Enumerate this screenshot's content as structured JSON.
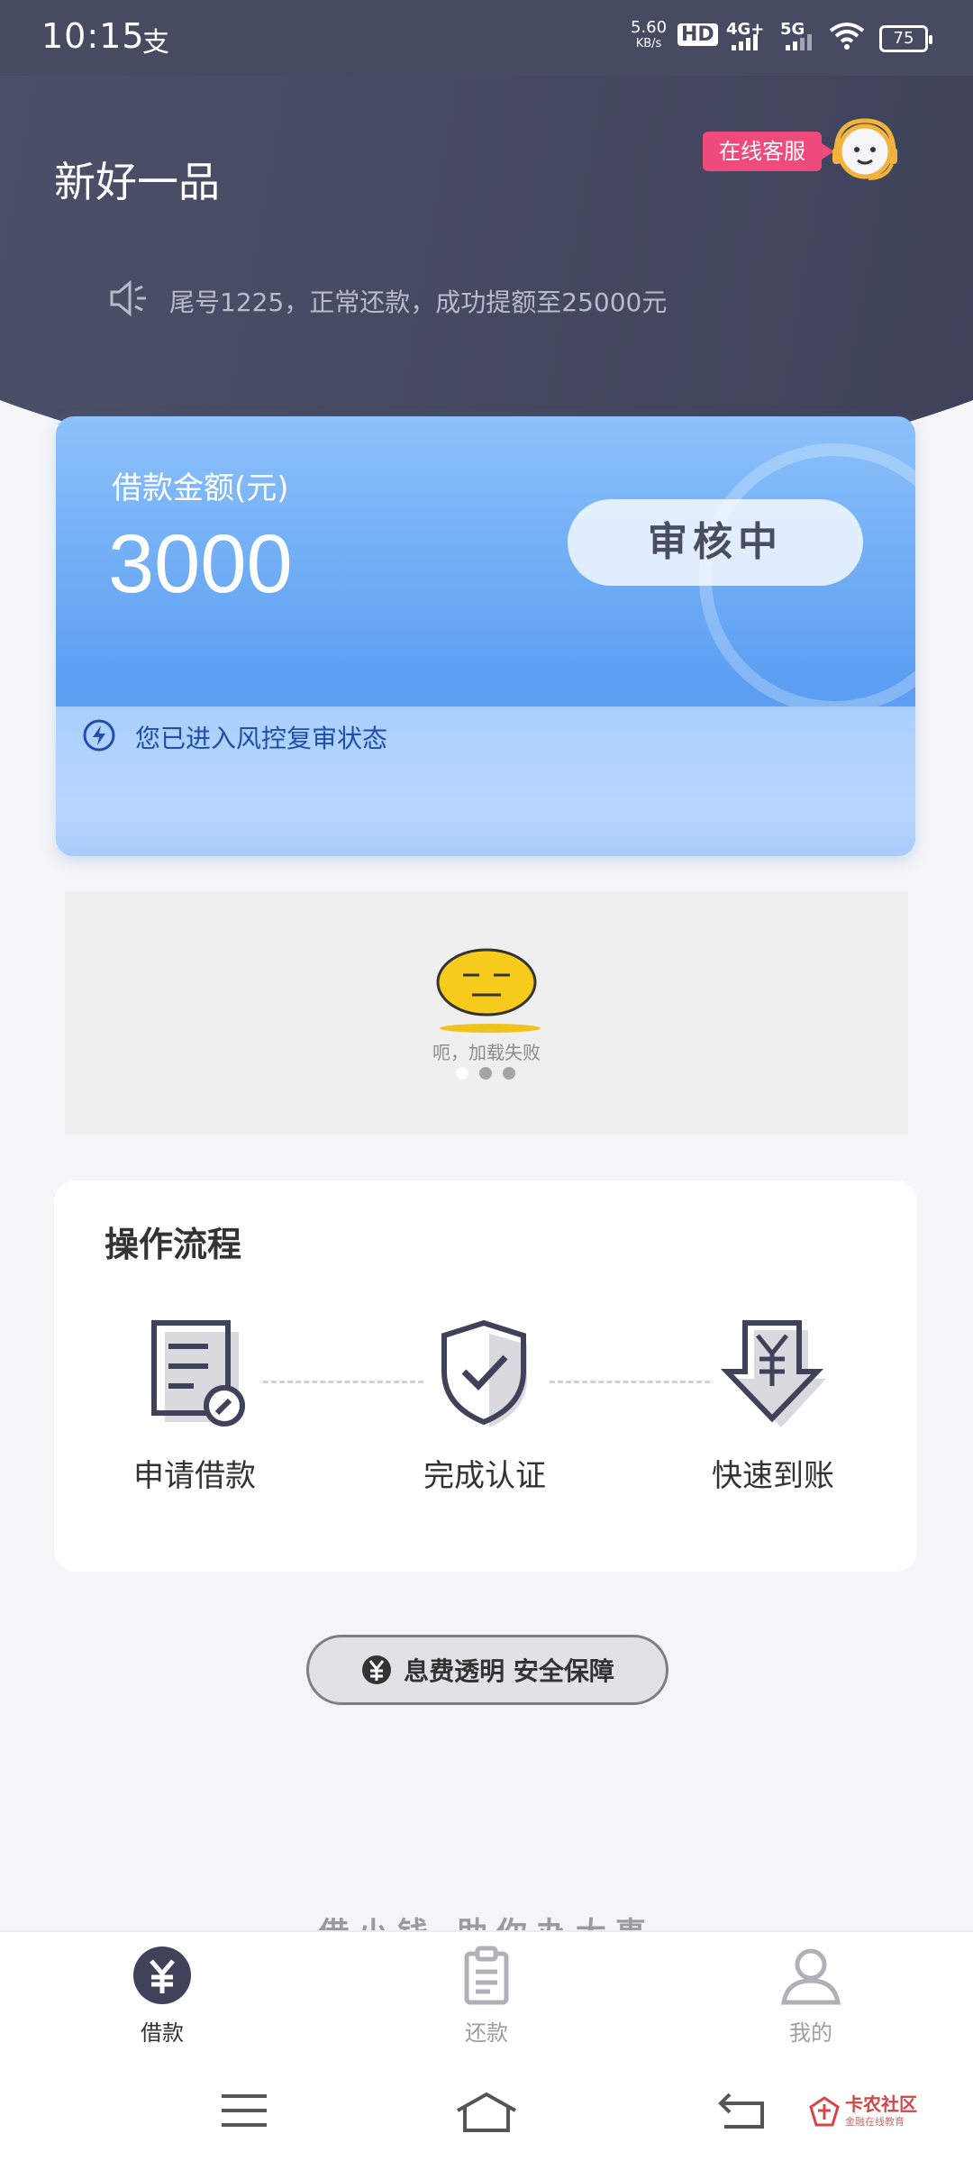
{
  "status_bar": {
    "time": "10:15",
    "app_indicator": "支",
    "speed_value": "5.60",
    "speed_unit": "KB/s",
    "hd_label": "HD",
    "network_4g": "4G+",
    "network_5g": "5G",
    "battery": "75"
  },
  "header": {
    "app_title": "新好一品",
    "service_label": "在线客服",
    "notice": "尾号1225，正常还款，成功提额至25000元"
  },
  "loan_card": {
    "label": "借款金额(元)",
    "amount": "3000",
    "status": "审核中",
    "footer_text": "您已进入风控复审状态"
  },
  "banner": {
    "error_text": "呃，加载失败",
    "dots": 3,
    "active_dot": 0
  },
  "process": {
    "title": "操作流程",
    "steps": [
      {
        "label": "申请借款",
        "icon": "document-edit-icon"
      },
      {
        "label": "完成认证",
        "icon": "shield-check-icon"
      },
      {
        "label": "快速到账",
        "icon": "yen-arrow-down-icon"
      }
    ]
  },
  "assurance": {
    "text": "息费透明 安全保障",
    "icon": "yen-circle-icon"
  },
  "slogan": "借小钱 助你办大事",
  "tab_bar": {
    "tabs": [
      {
        "label": "借款",
        "icon": "yen-icon",
        "active": true
      },
      {
        "label": "还款",
        "icon": "clipboard-icon",
        "active": false
      },
      {
        "label": "我的",
        "icon": "user-icon",
        "active": false
      }
    ]
  },
  "watermark": {
    "title": "卡农社区",
    "subtitle": "金融在线教育"
  },
  "colors": {
    "header_bg": "#474b62",
    "card_blue": "#5c9ff2",
    "service_pink": "#ee4a7b",
    "page_bg": "#f6f6f8"
  }
}
